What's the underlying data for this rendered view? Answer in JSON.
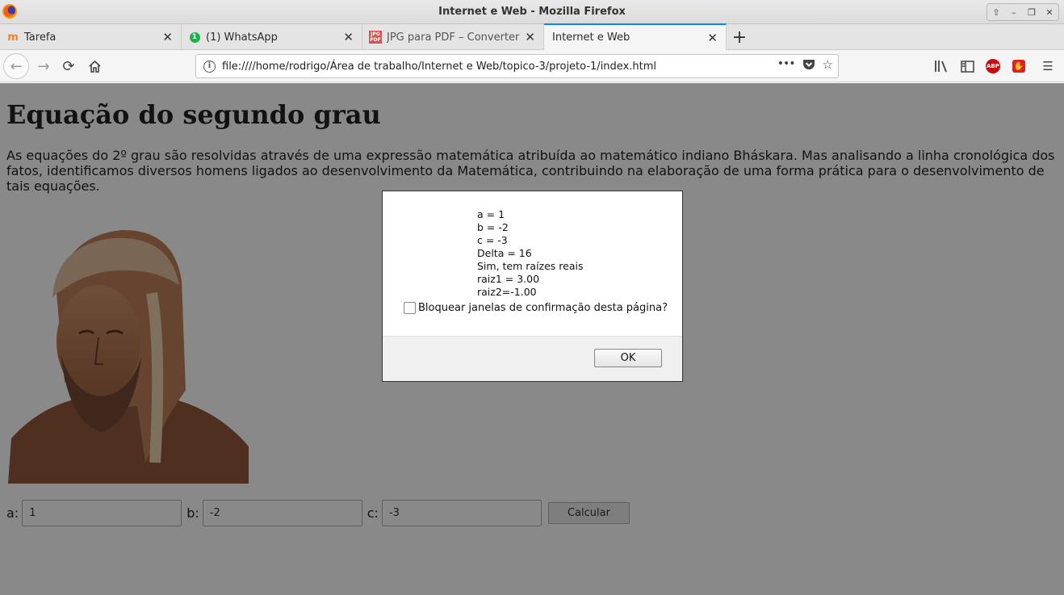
{
  "window": {
    "title": "Internet e Web - Mozilla Firefox"
  },
  "tabs": [
    {
      "label": "Tarefa",
      "icon": "moodle-icon"
    },
    {
      "label": "(1) WhatsApp",
      "icon": "whatsapp-icon",
      "badge": "1"
    },
    {
      "label": "JPG para PDF – Converter",
      "icon": "jpg-pdf-icon",
      "icon_text": "JPG PDF"
    },
    {
      "label": "Internet e Web",
      "icon": "",
      "active": true
    }
  ],
  "newtab_label": "+",
  "navbar": {
    "url": "file:////home/rodrigo/Área de trabalho/Internet e Web/topico-3/projeto-1/index.html",
    "page_actions_label": "•••",
    "abp_label": "ABP"
  },
  "page": {
    "heading": "Equação do segundo grau",
    "intro": "As equações do 2º grau são resolvidas através de uma expressão matemática atribuída ao matemático indiano Bháskara. Mas analisando a linha cronológica dos fatos, identificamos diversos homens ligados ao desenvolvimento da Matemática, contribuindo na elaboração de uma forma prática para o desenvolvimento de tais equações.",
    "form": {
      "a_label": "a:",
      "a_value": "1",
      "b_label": "b:",
      "b_value": "-2",
      "c_label": "c:",
      "c_value": "-3",
      "calc_label": "Calcular"
    }
  },
  "dialog": {
    "lines": [
      "a = 1",
      "b = -2",
      "c = -3",
      "Delta = 16",
      "Sim, tem raízes reais",
      "raiz1 = 3.00",
      "raiz2=-1.00"
    ],
    "checkbox_label": "Bloquear janelas de confirmação desta página?",
    "ok_label": "OK"
  }
}
